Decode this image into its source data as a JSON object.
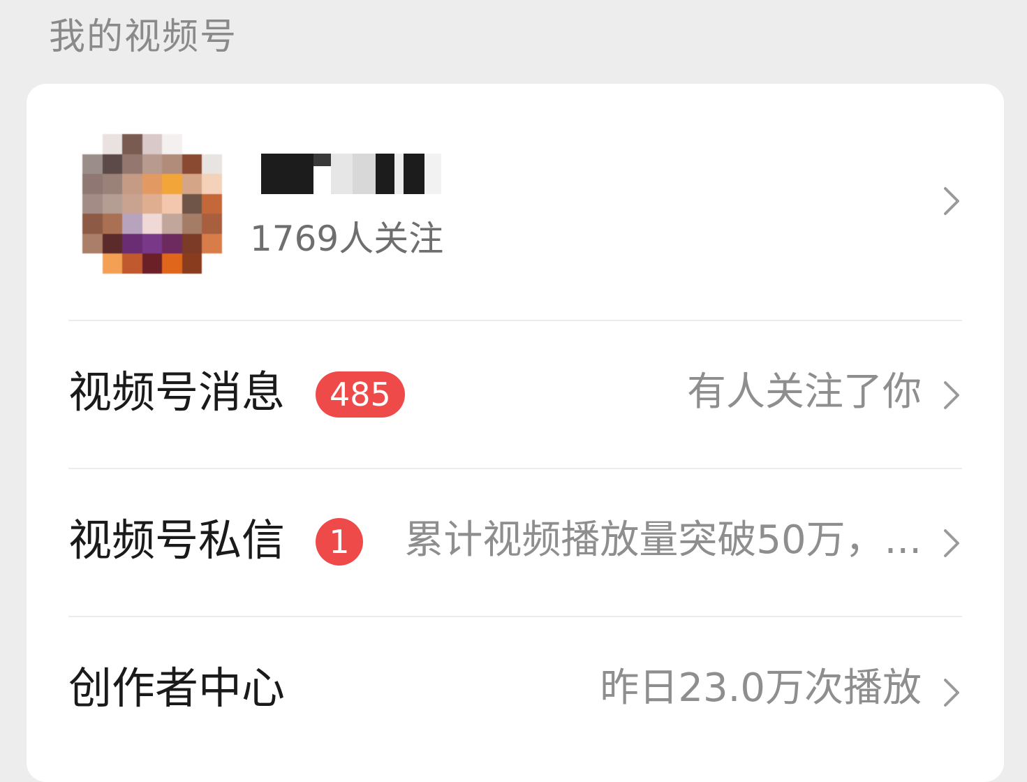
{
  "section": {
    "title": "我的视频号"
  },
  "profile": {
    "followers_text": "1769人关注",
    "avatar_colors": [
      [
        "#ffffff",
        "#e9e2e0",
        "#7a5b52",
        "#d9c9c8",
        "#f4f0ef",
        "#ffffff",
        "#ffffff"
      ],
      [
        "#9b8e8a",
        "#5b4a47",
        "#94786f",
        "#b89a8e",
        "#b28c7b",
        "#8a4a32",
        "#e7e4e2"
      ],
      [
        "#8f7873",
        "#9b8278",
        "#c59b86",
        "#e29a62",
        "#f2a63a",
        "#d4a687",
        "#f3d2b9"
      ],
      [
        "#a38c86",
        "#b49e94",
        "#c9a290",
        "#dfae90",
        "#f3c7ad",
        "#6e5548",
        "#c4683a"
      ],
      [
        "#8c5a45",
        "#a97054",
        "#b7a3bd",
        "#f0d8d6",
        "#c2a69b",
        "#a57c66",
        "#a85f3e"
      ],
      [
        "#ab7e6a",
        "#5a2b2a",
        "#6a2d74",
        "#7a3888",
        "#6c2a5e",
        "#7b3b27",
        "#d87c4a"
      ],
      [
        "#ffffff",
        "#f4a054",
        "#c05a2e",
        "#6b1f26",
        "#e0661b",
        "#8a3d1e",
        "#ffffff"
      ]
    ],
    "name_mosaic_colors": [
      "#1c1c1c",
      "#1c1c1c",
      "#3a3a3a",
      "#e6e6e6",
      "#d8d8d8",
      "#1c1c1c",
      "#ededed",
      "#1c1c1c",
      "#f2f2f2"
    ]
  },
  "rows": [
    {
      "label": "视频号消息",
      "badge": "485",
      "subtitle": "有人关注了你"
    },
    {
      "label": "视频号私信",
      "badge": "1",
      "subtitle": "累计视频播放量突破50万，..."
    },
    {
      "label": "创作者中心",
      "subtitle": "昨日23.0万次播放"
    }
  ],
  "colors": {
    "badge": "#ef4a4a",
    "background": "#ededed",
    "card": "#ffffff"
  }
}
